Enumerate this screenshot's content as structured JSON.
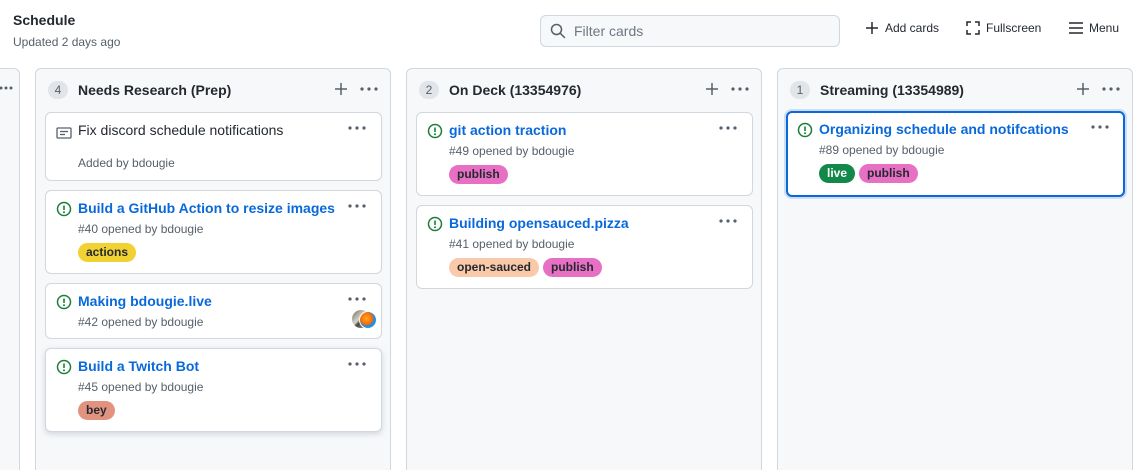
{
  "header": {
    "title": "Schedule",
    "updated": "Updated 2 days ago",
    "filter_placeholder": "Filter cards",
    "add_cards": "Add cards",
    "fullscreen": "Fullscreen",
    "menu": "Menu"
  },
  "colors": {
    "accent": "#0969da",
    "open_issue": "#1a7f37",
    "column_bg": "#f6f8fa"
  },
  "columns": [
    {
      "count": "4",
      "name": "Needs Research (Prep)",
      "cards": [
        {
          "type": "note",
          "title": "Fix discord schedule notifications",
          "meta": "Added by bdougie",
          "icon": "note-icon"
        },
        {
          "type": "issue",
          "title": "Build a GitHub Action to resize images",
          "meta": "#40 opened by bdougie",
          "labels": [
            {
              "text": "actions",
              "bg": "#f2d132",
              "fg": "#24292f"
            }
          ],
          "icon": "issue-open-icon"
        },
        {
          "type": "issue",
          "title": "Making bdougie.live",
          "meta": "#42 opened by bdougie",
          "icon": "issue-open-icon",
          "avatar": "assignee-avatars"
        },
        {
          "type": "issue",
          "title": "Build a Twitch Bot",
          "meta": "#45 opened by bdougie",
          "labels": [
            {
              "text": "bey",
              "bg": "#e19380",
              "fg": "#24292f"
            }
          ],
          "icon": "issue-open-icon"
        }
      ]
    },
    {
      "count": "2",
      "name": "On Deck (13354976)",
      "cards": [
        {
          "type": "issue",
          "title": "git action traction",
          "meta": "#49 opened by bdougie",
          "labels": [
            {
              "text": "publish",
              "bg": "#e76fc4",
              "fg": "#24292f"
            }
          ],
          "icon": "issue-open-icon"
        },
        {
          "type": "issue",
          "title": "Building opensauced.pizza",
          "meta": "#41 opened by bdougie",
          "labels": [
            {
              "text": "open-sauced",
              "bg": "#f9c9aa",
              "fg": "#24292f"
            },
            {
              "text": "publish",
              "bg": "#e76fc4",
              "fg": "#24292f"
            }
          ],
          "icon": "issue-open-icon"
        }
      ]
    },
    {
      "count": "1",
      "name": "Streaming (13354989)",
      "cards": [
        {
          "type": "issue",
          "title": "Organizing schedule and notifcations",
          "meta": "#89 opened by bdougie",
          "labels": [
            {
              "text": "live",
              "bg": "#12894a",
              "fg": "#ffffff"
            },
            {
              "text": "publish",
              "bg": "#e76fc4",
              "fg": "#24292f"
            }
          ],
          "icon": "issue-open-icon"
        }
      ]
    }
  ]
}
